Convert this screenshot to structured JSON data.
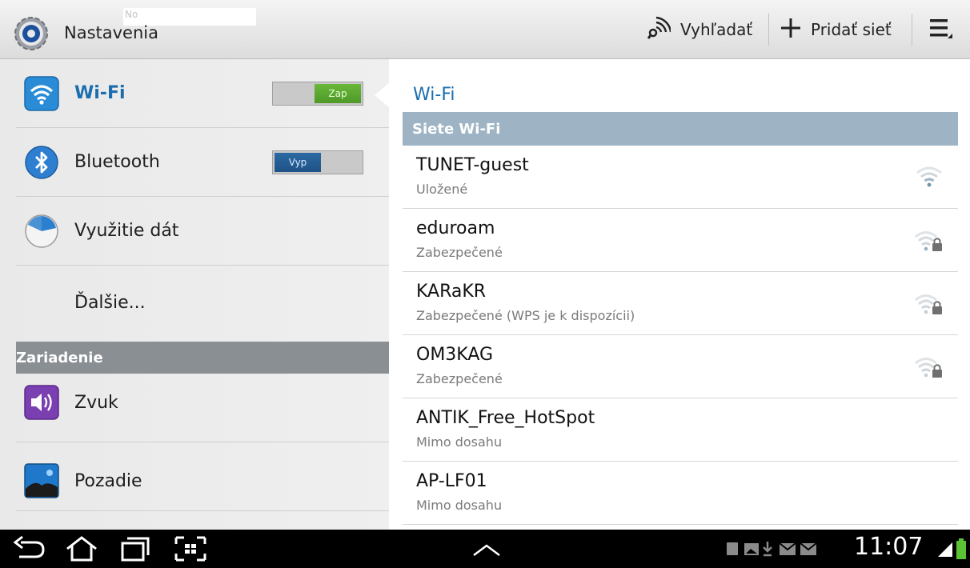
{
  "action_bar": {
    "title": "Nastavenia",
    "overlay_text": "No",
    "scan_label": "Vyhľadať",
    "add_label": "Pridať sieť"
  },
  "left_menu": {
    "items": [
      {
        "label": "Wi-Fi",
        "toggle": "Zap",
        "icon": "wifi-icon"
      },
      {
        "label": "Bluetooth",
        "toggle": "Vyp",
        "icon": "bluetooth-icon"
      },
      {
        "label": "Využitie dát",
        "icon": "data-usage-icon"
      },
      {
        "label": "Ďalšie..."
      }
    ],
    "section": "Zariadenie",
    "device_items": [
      {
        "label": "Zvuk",
        "icon": "sound-icon"
      },
      {
        "label": "Pozadie",
        "icon": "wallpaper-icon"
      }
    ]
  },
  "detail": {
    "title": "Wi-Fi",
    "subheader": "Siete Wi-Fi",
    "networks": [
      {
        "ssid": "TUNET-guest",
        "status": "Uložené",
        "signal_icon": "wifi-signal-icon"
      },
      {
        "ssid": "eduroam",
        "status": "Zabezpečené",
        "signal_icon": "wifi-lock-icon"
      },
      {
        "ssid": "KARaKR",
        "status": "Zabezpečené (WPS je k dispozícii)",
        "signal_icon": "wifi-lock-icon"
      },
      {
        "ssid": "OM3KAG",
        "status": "Zabezpečené",
        "signal_icon": "wifi-lock-icon"
      },
      {
        "ssid": "ANTIK_Free_HotSpot",
        "status": "Mimo dosahu"
      },
      {
        "ssid": "AP-LF01",
        "status": "Mimo dosahu"
      }
    ]
  },
  "status_bar": {
    "time": "11:07"
  },
  "colors": {
    "accent": "#1b6eae",
    "toggle_on": "#5aa832",
    "toggle_off": "#245d96"
  }
}
